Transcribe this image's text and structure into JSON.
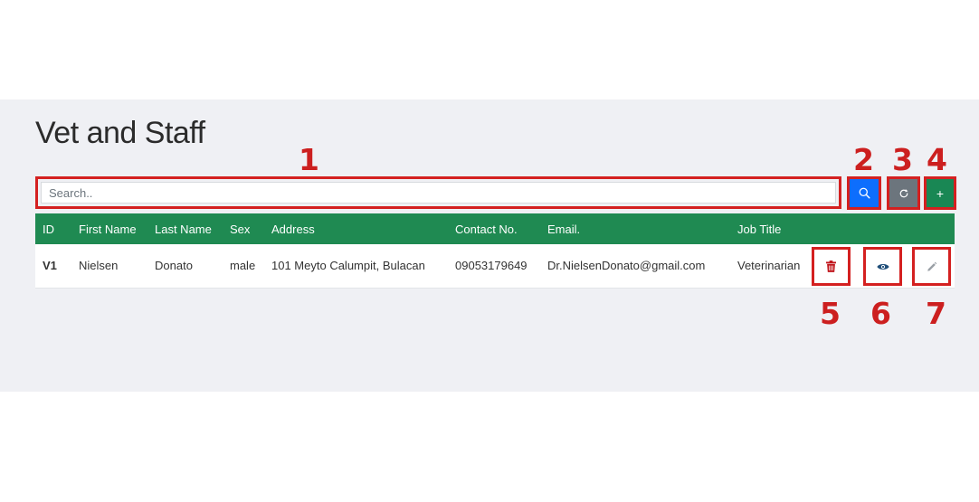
{
  "page": {
    "title": "Vet and Staff"
  },
  "search": {
    "placeholder": "Search.."
  },
  "toolbar": {
    "search_icon": "search-icon",
    "refresh_icon": "refresh-icon",
    "add_label": "+"
  },
  "callouts": [
    "1",
    "2",
    "3",
    "4",
    "5",
    "6",
    "7"
  ],
  "table": {
    "headers": [
      "ID",
      "First Name",
      "Last Name",
      "Sex",
      "Address",
      "Contact No.",
      "Email.",
      "Job Title"
    ],
    "rows": [
      {
        "id": "V1",
        "first_name": "Nielsen",
        "last_name": "Donato",
        "sex": "male",
        "address": "101 Meyto Calumpit, Bulacan",
        "contact": "09053179649",
        "email": "Dr.NielsenDonato@gmail.com",
        "job_title": "Veterinarian"
      }
    ],
    "actions": [
      "trash-icon",
      "eye-icon",
      "pencil-icon"
    ]
  },
  "colors": {
    "header_bg": "#1f8a52",
    "search_btn": "#0d6efd",
    "refresh_btn": "#6c757d",
    "add_btn": "#198754",
    "delete_icon": "#c0141b",
    "view_icon": "#1f4e79",
    "edit_icon": "#9aa0a6",
    "callout": "#cc1f1f"
  }
}
